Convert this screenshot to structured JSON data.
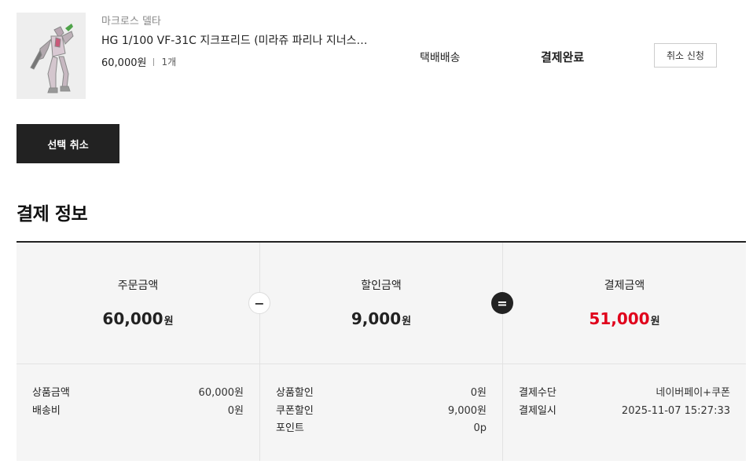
{
  "product": {
    "brand": "마크로스 델타",
    "name": "HG 1/100 VF-31C 지크프리드 (미라쥬 파리나 지너스 …",
    "price": "60,000원",
    "quantity": "1개",
    "shipping": "택배배송",
    "status": "결제완료",
    "cancel_request_label": "취소 신청"
  },
  "select_cancel_label": "선택 취소",
  "payment_section_title": "결제 정보",
  "summary": {
    "order": {
      "label": "주문금액",
      "amount": "60,000",
      "unit": "원"
    },
    "discount": {
      "label": "할인금액",
      "amount": "9,000",
      "unit": "원"
    },
    "payment": {
      "label": "결제금액",
      "amount": "51,000",
      "unit": "원"
    },
    "minus_symbol": "−",
    "equal_symbol": "="
  },
  "details": {
    "order": [
      {
        "label": "상품금액",
        "value": "60,000원"
      },
      {
        "label": "배송비",
        "value": "0원"
      }
    ],
    "discount": [
      {
        "label": "상품할인",
        "value": "0원"
      },
      {
        "label": "쿠폰할인",
        "value": "9,000원"
      },
      {
        "label": "포인트",
        "value": "0p"
      }
    ],
    "payment": [
      {
        "label": "결제수단",
        "value": "네이버페이+쿠폰"
      },
      {
        "label": "결제일시",
        "value": "2025-11-07 15:27:33"
      }
    ]
  },
  "colors": {
    "accent_red": "#e0001b",
    "dark_button": "#222222",
    "panel_bg": "#f5f5f5"
  }
}
